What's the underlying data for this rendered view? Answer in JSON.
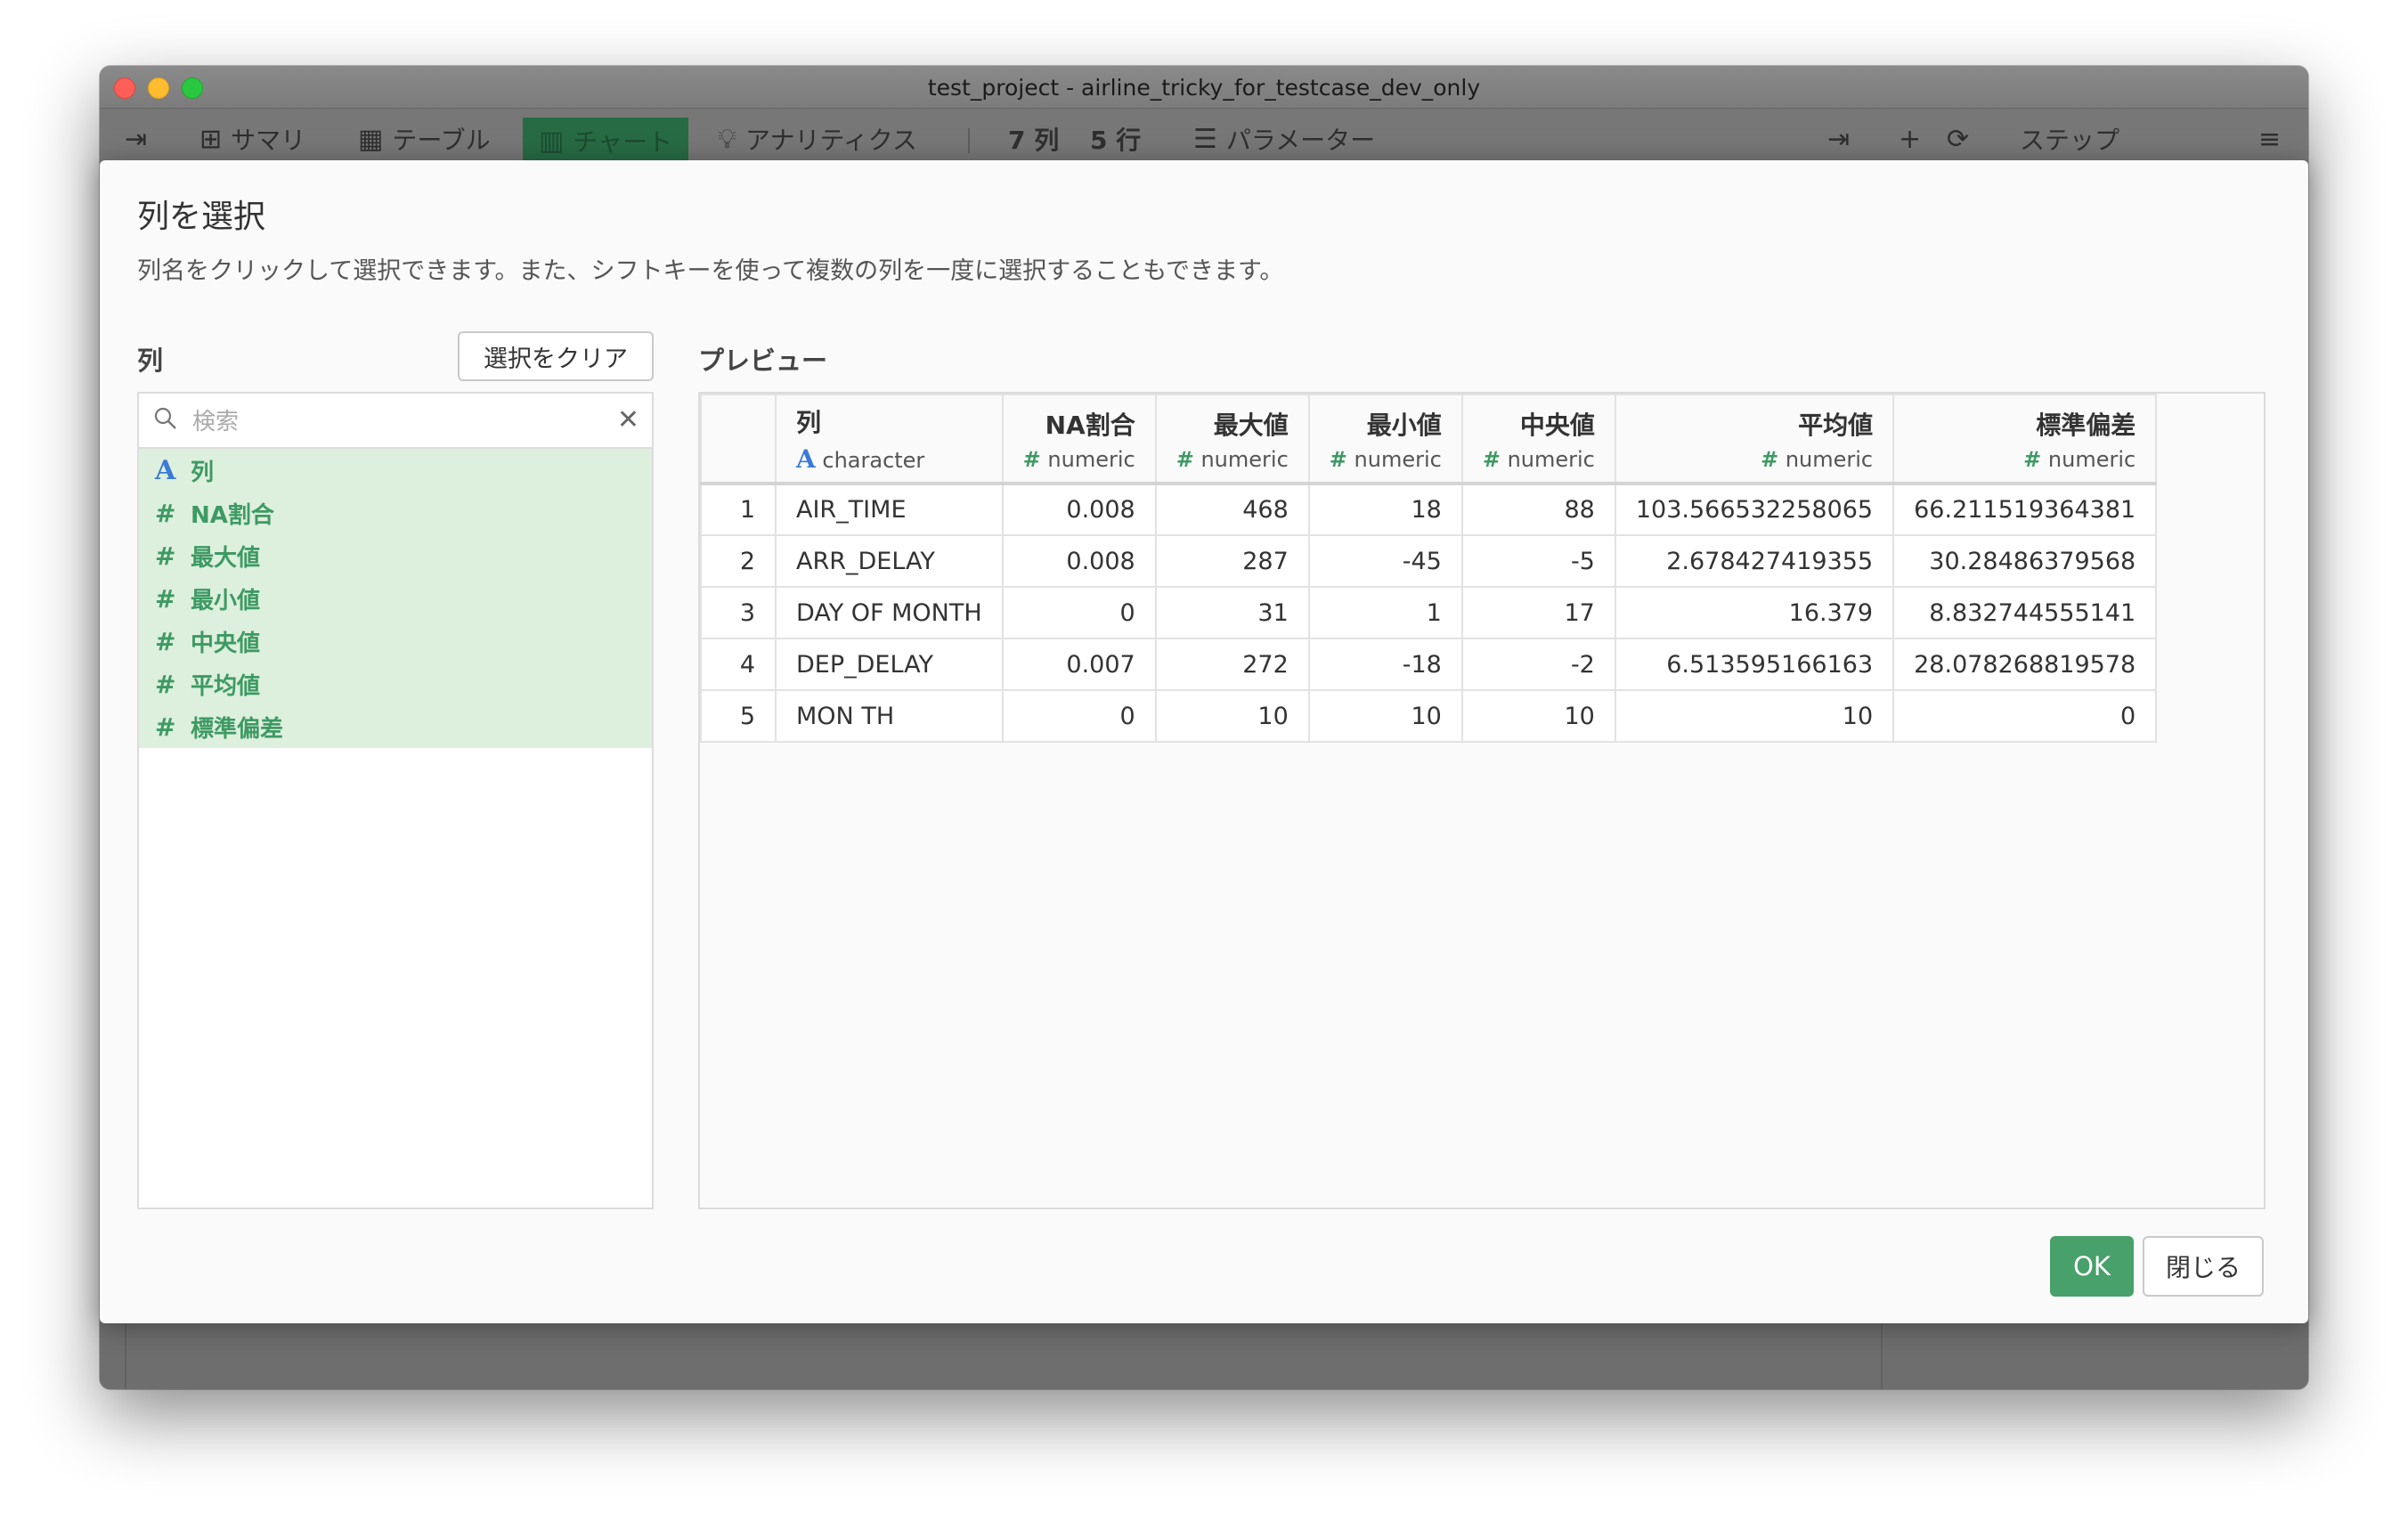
{
  "window": {
    "title": "test_project - airline_tricky_for_testcase_dev_only"
  },
  "toolbar": {
    "tabs": [
      {
        "label": "サマリ"
      },
      {
        "label": "テーブル"
      },
      {
        "label": "チャート"
      },
      {
        "label": "アナリティクス"
      }
    ],
    "column_count": "7 列",
    "row_count": "5 行",
    "parameter_label": "パラメーター",
    "step_label": "ステップ"
  },
  "dialog": {
    "title": "列を選択",
    "description": "列名をクリックして選択できます。また、シフトキーを使って複数の列を一度に選択することもできます。",
    "columns_label": "列",
    "clear_selection": "選択をクリア",
    "preview_label": "プレビュー",
    "search_placeholder": "検索",
    "ok": "OK",
    "close": "閉じる"
  },
  "column_list": [
    {
      "type": "A",
      "name": "列"
    },
    {
      "type": "#",
      "name": "NA割合"
    },
    {
      "type": "#",
      "name": "最大値"
    },
    {
      "type": "#",
      "name": "最小値"
    },
    {
      "type": "#",
      "name": "中央値"
    },
    {
      "type": "#",
      "name": "平均値"
    },
    {
      "type": "#",
      "name": "標準偏差"
    }
  ],
  "table": {
    "headers": [
      {
        "name": "列",
        "type_icon": "A",
        "type": "character"
      },
      {
        "name": "NA割合",
        "type_icon": "#",
        "type": "numeric"
      },
      {
        "name": "最大値",
        "type_icon": "#",
        "type": "numeric"
      },
      {
        "name": "最小値",
        "type_icon": "#",
        "type": "numeric"
      },
      {
        "name": "中央値",
        "type_icon": "#",
        "type": "numeric"
      },
      {
        "name": "平均値",
        "type_icon": "#",
        "type": "numeric"
      },
      {
        "name": "標準偏差",
        "type_icon": "#",
        "type": "numeric"
      }
    ],
    "rows": [
      [
        "1",
        "AIR_TIME",
        "0.008",
        "468",
        "18",
        "88",
        "103.566532258065",
        "66.211519364381"
      ],
      [
        "2",
        "ARR_DELAY",
        "0.008",
        "287",
        "-45",
        "-5",
        "2.678427419355",
        "30.28486379568"
      ],
      [
        "3",
        "DAY OF MONTH",
        "0",
        "31",
        "1",
        "17",
        "16.379",
        "8.832744555141"
      ],
      [
        "4",
        "DEP_DELAY",
        "0.007",
        "272",
        "-18",
        "-2",
        "6.513595166163",
        "28.078268819578"
      ],
      [
        "5",
        "MON TH",
        "0",
        "10",
        "10",
        "10",
        "10",
        "0"
      ]
    ]
  }
}
